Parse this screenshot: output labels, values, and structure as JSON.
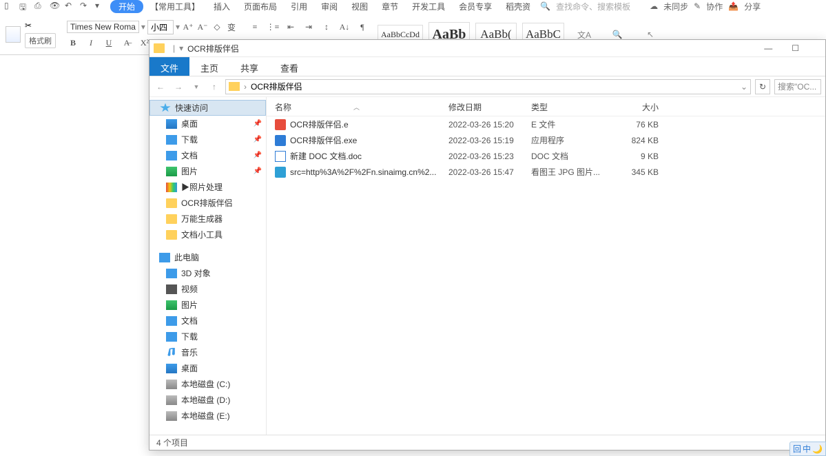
{
  "word": {
    "qat_icons": [
      "file",
      "save",
      "print",
      "preview",
      "undo",
      "redo"
    ],
    "tabs": {
      "start": "开始",
      "common": "【常用工具】",
      "insert": "插入",
      "layout": "页面布局",
      "ref": "引用",
      "review": "审阅",
      "view": "视图",
      "section": "章节",
      "dev": "开发工具",
      "vip": "会员专享",
      "template": "稻壳资"
    },
    "right": {
      "search_placeholder": "查找命令、搜索模板",
      "unsync": "未同步",
      "coop": "协作",
      "share": "分享"
    },
    "clipboard": {
      "fmt": "格式刷"
    },
    "font": {
      "name": "Times New Roma",
      "size": "小四"
    },
    "buttons": {
      "bold": "B",
      "italic": "I",
      "underline": "U"
    },
    "styles": {
      "s1": "AaBbCcDd",
      "s2": "AaBb",
      "s3": "AaBb(",
      "s4": "AaBbC"
    }
  },
  "explorer": {
    "title": "OCR排版伴侣",
    "menu": {
      "file": "文件",
      "home": "主页",
      "share": "共享",
      "view": "查看"
    },
    "breadcrumb": "OCR排版伴侣",
    "search_placeholder": "搜索\"OC...",
    "headers": {
      "name": "名称",
      "date": "修改日期",
      "type": "类型",
      "size": "大小"
    },
    "nav": {
      "quick": "快速访问",
      "desktop": "桌面",
      "downloads": "下载",
      "docs": "文档",
      "pics": "图片",
      "photo": "▶照片处理",
      "ocr": "OCR排版伴侣",
      "gen": "万能生成器",
      "doctool": "文档小工具",
      "pc": "此电脑",
      "3d": "3D 对象",
      "video": "视频",
      "pics2": "图片",
      "docs2": "文档",
      "downloads2": "下载",
      "music": "音乐",
      "desktop2": "桌面",
      "c": "本地磁盘 (C:)",
      "d": "本地磁盘 (D:)",
      "e": "本地磁盘 (E:)"
    },
    "files": [
      {
        "icon": "e",
        "name": "OCR排版伴侣.e",
        "date": "2022-03-26 15:20",
        "type": "E 文件",
        "size": "76 KB"
      },
      {
        "icon": "exe",
        "name": "OCR排版伴侣.exe",
        "date": "2022-03-26 15:19",
        "type": "应用程序",
        "size": "824 KB"
      },
      {
        "icon": "doc",
        "name": "新建 DOC 文档.doc",
        "date": "2022-03-26 15:23",
        "type": "DOC 文档",
        "size": "9 KB"
      },
      {
        "icon": "jpg",
        "name": "src=http%3A%2F%2Fn.sinaimg.cn%2...",
        "date": "2022-03-26 15:47",
        "type": "看图王 JPG 图片...",
        "size": "345 KB"
      }
    ],
    "status": "4 个项目"
  },
  "ime": {
    "a": "回",
    "b": "中"
  }
}
